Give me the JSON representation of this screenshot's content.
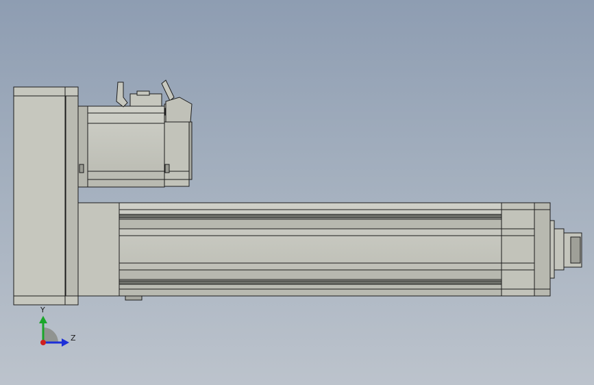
{
  "triad": {
    "y_label": "Y",
    "z_label": "Z",
    "y_color": "#1aa62a",
    "z_color": "#1d2fd8",
    "x_color": "#d0201e"
  },
  "colors": {
    "part_fill": "#c5c6bd",
    "part_dark": "#8f918a",
    "edge": "#1b1b1b"
  }
}
